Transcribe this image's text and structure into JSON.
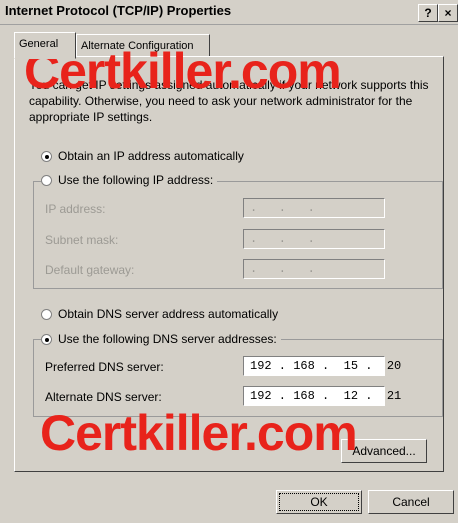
{
  "window": {
    "title": "Internet Protocol (TCP/IP) Properties",
    "help_label": "?",
    "close_label": "×"
  },
  "tabs": [
    {
      "label": "General"
    },
    {
      "label": "Alternate Configuration"
    }
  ],
  "general": {
    "description": "You can get IP settings assigned automatically if your network supports this capability. Otherwise, you need to ask your network administrator for the appropriate IP settings.",
    "ip_auto_label": "Obtain an IP address automatically",
    "ip_manual_label": "Use the following IP address:",
    "ip_address_label": "IP address:",
    "subnet_label": "Subnet mask:",
    "gateway_label": "Default gateway:",
    "ip_address_value": ".   .   .",
    "subnet_value": ".   .   .",
    "gateway_value": ".   .   .",
    "dns_auto_label": "Obtain DNS server address automatically",
    "dns_manual_label": "Use the following DNS server addresses:",
    "preferred_dns_label": "Preferred DNS server:",
    "alternate_dns_label": "Alternate DNS server:",
    "preferred_dns_value": "192 . 168 .  15 .  20",
    "alternate_dns_value": "192 . 168 .  12 .  21",
    "advanced_label": "Advanced..."
  },
  "footer": {
    "ok_label": "OK",
    "cancel_label": "Cancel"
  },
  "watermark": {
    "text_top": "Certkiller.com",
    "text_bottom": "Certkiller.com"
  }
}
